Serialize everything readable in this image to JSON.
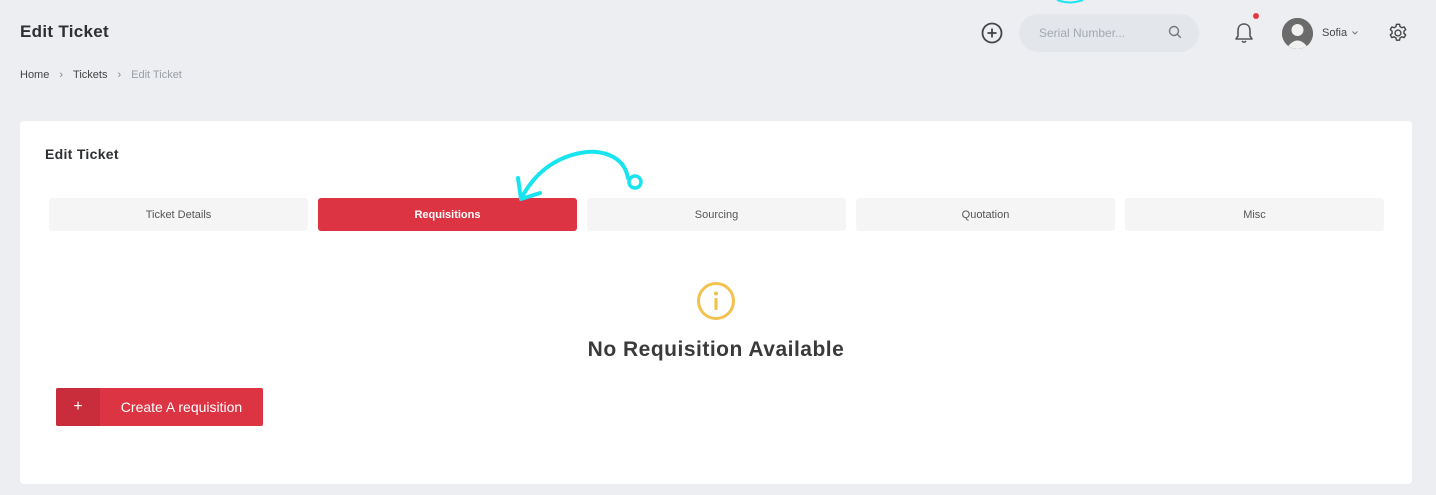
{
  "header": {
    "title": "Edit Ticket",
    "search_placeholder": "Serial Number...",
    "user_name": "Sofia"
  },
  "breadcrumb": {
    "items": [
      "Home",
      "Tickets",
      "Edit Ticket"
    ]
  },
  "card": {
    "title": "Edit Ticket",
    "tabs": [
      {
        "label": "Ticket Details",
        "active": false
      },
      {
        "label": "Requisitions",
        "active": true
      },
      {
        "label": "Sourcing",
        "active": false
      },
      {
        "label": "Quotation",
        "active": false
      },
      {
        "label": "Misc",
        "active": false
      }
    ],
    "empty_message": "No Requisition Available",
    "create_button": {
      "icon": "+",
      "label": "Create A requisition"
    }
  },
  "colors": {
    "accent": "#dd3444",
    "info_icon": "#f2c14e",
    "annotation": "#18e4ef",
    "notification_dot": "#e63946"
  },
  "icons": [
    "plus-circle-icon",
    "search-icon",
    "bell-icon",
    "avatar",
    "chevron-down-icon",
    "gear-icon",
    "info-icon",
    "plus-icon"
  ]
}
